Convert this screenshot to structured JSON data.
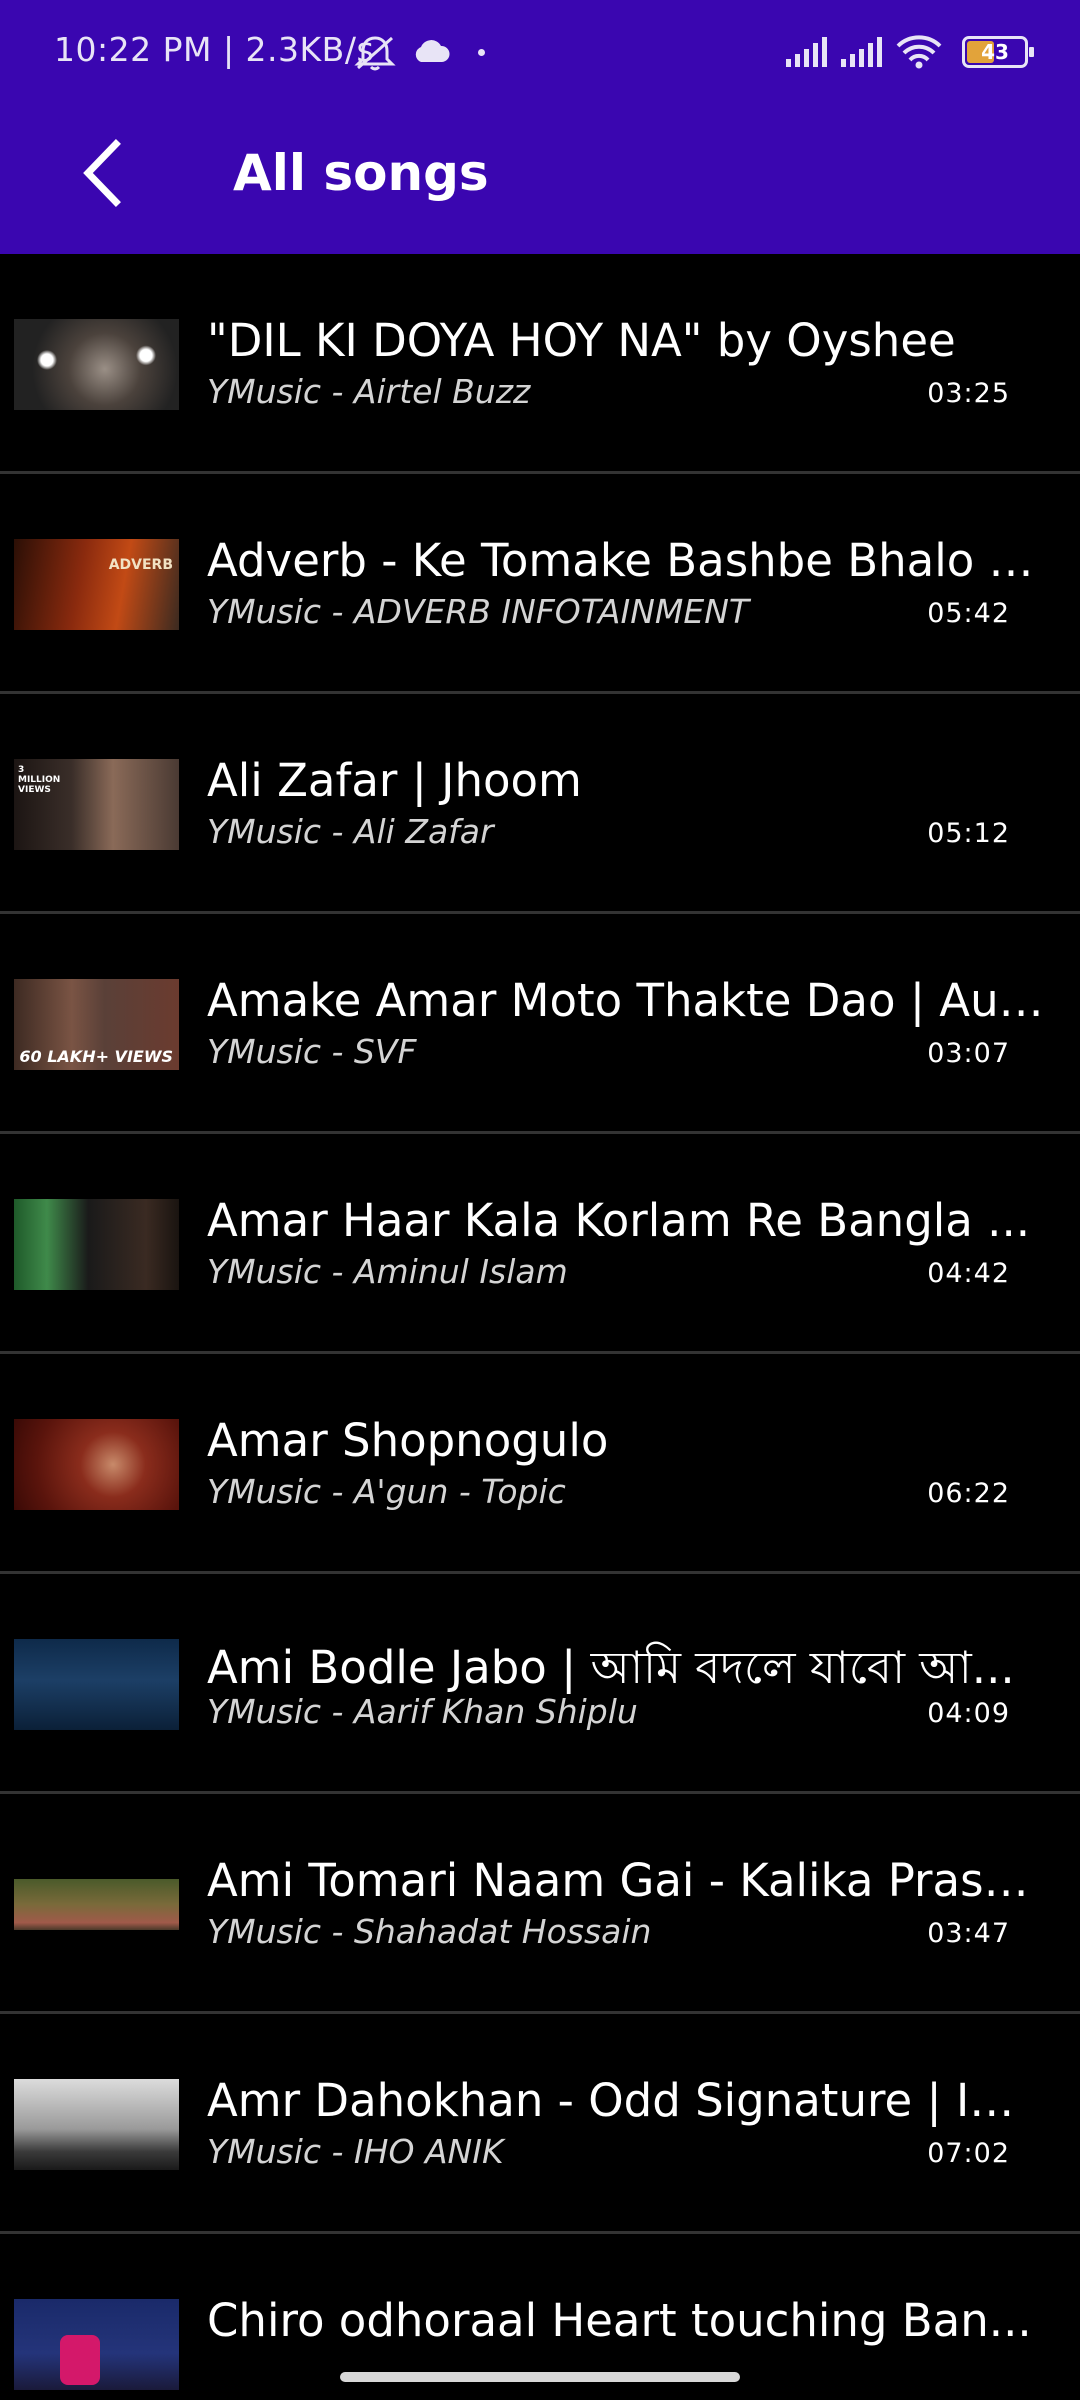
{
  "status_bar": {
    "time_speed": "10:22 PM | 2.3KB/s",
    "battery_level": "43",
    "icons": [
      "bell-off-icon",
      "cloud-icon",
      "dot-icon",
      "signal-icon",
      "signal-icon",
      "wifi-icon",
      "battery-icon"
    ]
  },
  "header": {
    "back_icon": "chevron-left-icon",
    "title": "All songs",
    "background_color": "#3a06b0"
  },
  "songs": [
    {
      "title": "\"DIL KI DOYA HOY NA\" by Oyshee",
      "subtitle": "YMusic - Airtel Buzz",
      "duration": "03:25",
      "thumb_text": ""
    },
    {
      "title": "Adverb - Ke Tomake Bashbe Bhalo | ...",
      "subtitle": "YMusic - ADVERB INFOTAINMENT",
      "duration": "05:42",
      "thumb_text": "ADVERB"
    },
    {
      "title": "Ali Zafar | Jhoom",
      "subtitle": "YMusic - Ali Zafar",
      "duration": "05:12",
      "thumb_text": "3 MILLION VIEWS"
    },
    {
      "title": "Amake Amar Moto Thakte Dao | Aut...",
      "subtitle": "YMusic - SVF",
      "duration": "03:07",
      "thumb_text": "60 LAKH+ VIEWS"
    },
    {
      "title": "Amar Haar Kala Korlam Re   Bangla ...",
      "subtitle": "YMusic - Aminul Islam",
      "duration": "04:42",
      "thumb_text": ""
    },
    {
      "title": "Amar Shopnogulo",
      "subtitle": "YMusic - A'gun - Topic",
      "duration": "06:22",
      "thumb_text": ""
    },
    {
      "title": "Ami Bodle Jabo | আমি বদলে যাবো আ...",
      "subtitle": "YMusic - Aarif Khan Shiplu",
      "duration": "04:09",
      "thumb_text": ""
    },
    {
      "title": "Ami Tomari Naam Gai - Kalika Prasa...",
      "subtitle": "YMusic - Shahadat Hossain",
      "duration": "03:47",
      "thumb_text": ""
    },
    {
      "title": "Amr Dahokhan - Odd Signature | IH...",
      "subtitle": "YMusic - IHO ANIK",
      "duration": "07:02",
      "thumb_text": ""
    },
    {
      "title": "Chiro odhoraal Heart touching Ban...",
      "subtitle": "",
      "duration": "",
      "thumb_text": ""
    }
  ]
}
